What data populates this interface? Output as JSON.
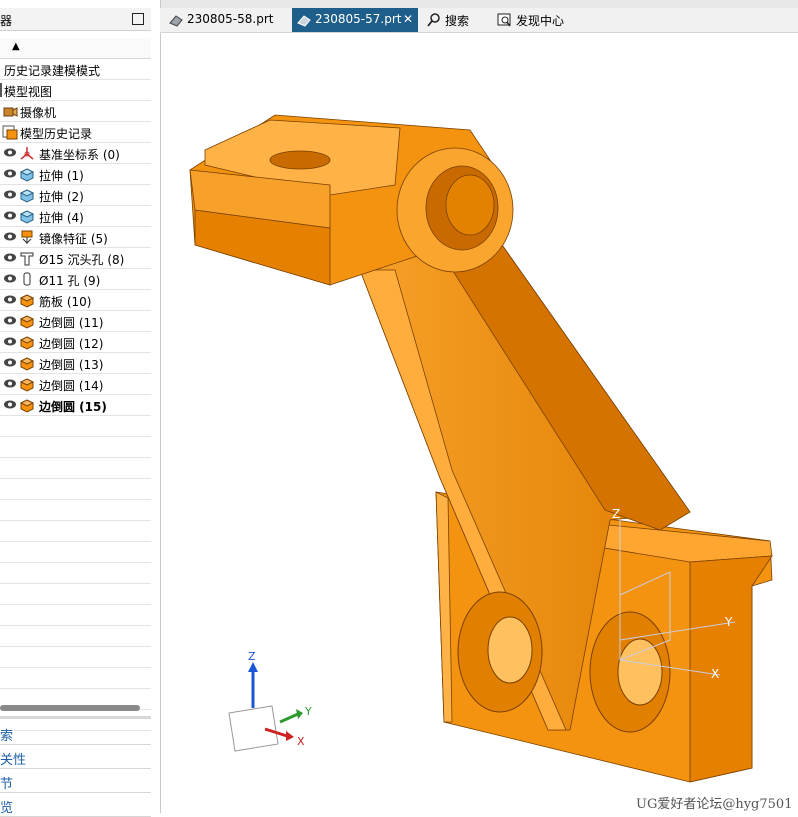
{
  "navigator": {
    "title": "导航器",
    "title_visible": "导航器",
    "column_sort_arrow": "▲",
    "items": [
      {
        "label": "历史记录建模模式",
        "icon": "none"
      },
      {
        "label": "模型视图",
        "icon": "none"
      },
      {
        "label": "摄像机",
        "icon": "camera-icon"
      },
      {
        "label": "模型历史记录",
        "icon": "history-folder-icon"
      },
      {
        "label": "基准坐标系 (0)",
        "icon": "datum-csys-icon"
      },
      {
        "label": "拉伸 (1)",
        "icon": "extrude-icon"
      },
      {
        "label": "拉伸 (2)",
        "icon": "extrude-icon"
      },
      {
        "label": "拉伸 (4)",
        "icon": "extrude-icon"
      },
      {
        "label": "镜像特征 (5)",
        "icon": "mirror-feature-icon"
      },
      {
        "label": "Ø15 沉头孔 (8)",
        "icon": "counterbore-hole-icon"
      },
      {
        "label": "Ø11 孔 (9)",
        "icon": "hole-icon"
      },
      {
        "label": "筋板 (10)",
        "icon": "rib-icon"
      },
      {
        "label": "边倒圆 (11)",
        "icon": "edge-blend-icon"
      },
      {
        "label": "边倒圆 (12)",
        "icon": "edge-blend-icon"
      },
      {
        "label": "边倒圆 (13)",
        "icon": "edge-blend-icon"
      },
      {
        "label": "边倒圆 (14)",
        "icon": "edge-blend-icon"
      },
      {
        "label": "边倒圆 (15)",
        "icon": "edge-blend-icon"
      }
    ],
    "sections": [
      "搜索",
      "相关性",
      "细节",
      "预览"
    ]
  },
  "tabs": [
    {
      "label": "230805-58.prt",
      "icon": "part-file-icon",
      "active": false
    },
    {
      "label": "230805-57.prt",
      "icon": "part-file-icon",
      "active": true,
      "close": "✕"
    },
    {
      "label": "搜索",
      "icon": "search-icon",
      "active": false
    },
    {
      "label": "发现中心",
      "icon": "discovery-icon",
      "active": false
    }
  ],
  "viewport": {
    "triad_labels": {
      "z": "Z",
      "y": "Y",
      "x": "X"
    },
    "csys_labels": {
      "z": "Z",
      "y": "Y",
      "x": "X"
    }
  },
  "watermark": "UG爱好者论坛@hyg7501",
  "colors": {
    "model": "#f5920f",
    "active_tab": "#1d5e8a",
    "section_text": "#1c5fa8"
  }
}
